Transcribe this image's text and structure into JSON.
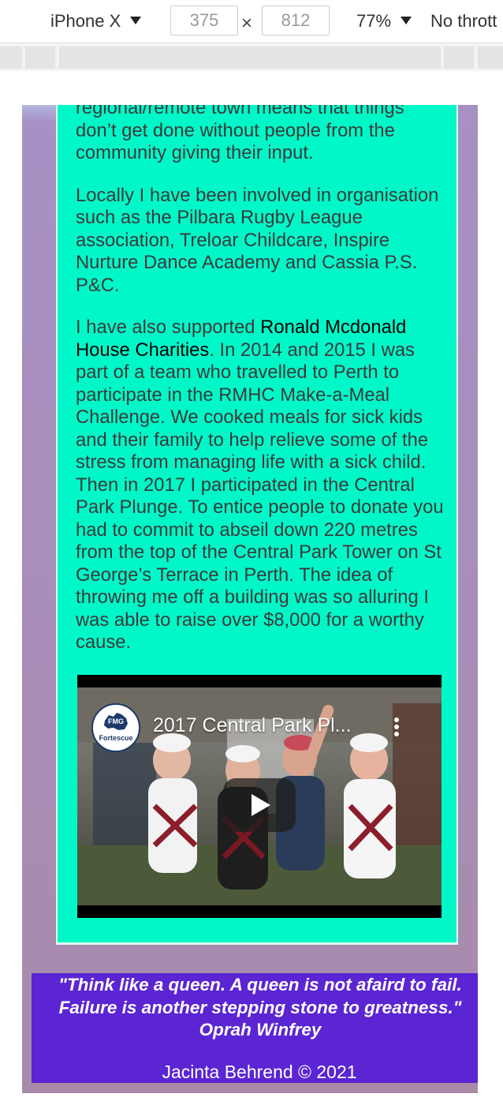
{
  "devtools": {
    "device": "iPhone X",
    "width": "375",
    "height": "812",
    "separator": "×",
    "zoom": "77%",
    "throttling": "No thrott"
  },
  "content": {
    "paragraph_1": "regional/remote town means that things don’t get done without people from the community giving their input.",
    "paragraph_2": "Locally I have been involved in organisation such as the Pilbara Rugby League association, Treloar Childcare, Inspire Nurture Dance Academy and Cassia P.S. P&C.",
    "paragraph_3_lead": "I have also supported ",
    "charity_link": "Ronald Mcdonald House Charities",
    "paragraph_3_rest": ". In 2014 and 2015 I was part of a team who travelled to Perth to participate in the RMHC Make-a-Meal Challenge. We cooked meals for sick kids and their family to help relieve some of the stress from managing life with a sick child. Then in 2017 I participated in the Central Park Plunge. To entice people to donate you had to commit to abseil down 220 metres from the top of the Central Park Tower on St George’s Terrace in Perth. The idea of throwing me off a building was so alluring I was able to raise over $8,000 for a worthy cause."
  },
  "video": {
    "title": "2017 Central Park Pl...",
    "channel_initials": "FMG",
    "channel_name": "Fortescue"
  },
  "footer": {
    "quote_line_1": "\"Think like a queen. A queen is not afaird to fail.",
    "quote_line_2": "Failure is another stepping stone to greatness.\"",
    "quote_author": "Oprah Winfrey",
    "copyright": "Jacinta Behrend © 2021"
  },
  "colors": {
    "panel": "#00f8c9",
    "page_background": "#a98db8",
    "footer": "#5b25d3",
    "link": "#000000"
  },
  "icons": {
    "play": "play-icon",
    "more": "more-vertical-icon",
    "device_caret": "chevron-down-icon"
  }
}
